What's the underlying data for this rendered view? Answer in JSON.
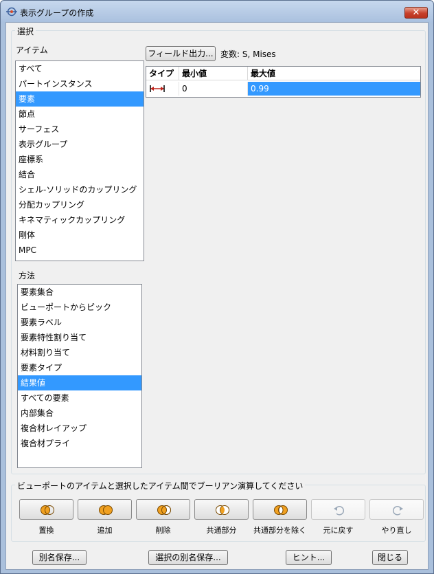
{
  "window": {
    "title": "表示グループの作成",
    "close_label": "✕"
  },
  "selection": {
    "legend": "選択",
    "items_label": "アイテム",
    "items": [
      {
        "label": "すべて",
        "selected": false
      },
      {
        "label": "パートインスタンス",
        "selected": false
      },
      {
        "label": "要素",
        "selected": true
      },
      {
        "label": "節点",
        "selected": false
      },
      {
        "label": "サーフェス",
        "selected": false
      },
      {
        "label": "表示グループ",
        "selected": false
      },
      {
        "label": "座標系",
        "selected": false
      },
      {
        "label": "結合",
        "selected": false
      },
      {
        "label": "シェル-ソリッドのカップリング",
        "selected": false
      },
      {
        "label": "分配カップリング",
        "selected": false
      },
      {
        "label": "キネマティックカップリング",
        "selected": false
      },
      {
        "label": "剛体",
        "selected": false
      },
      {
        "label": "MPC",
        "selected": false
      }
    ],
    "method_label": "方法",
    "methods": [
      {
        "label": "要素集合",
        "selected": false
      },
      {
        "label": "ビューポートからピック",
        "selected": false
      },
      {
        "label": "要素ラベル",
        "selected": false
      },
      {
        "label": "要素特性割り当て",
        "selected": false
      },
      {
        "label": "材料割り当て",
        "selected": false
      },
      {
        "label": "要素タイプ",
        "selected": false
      },
      {
        "label": "結果値",
        "selected": true
      },
      {
        "label": "すべての要素",
        "selected": false
      },
      {
        "label": "内部集合",
        "selected": false
      },
      {
        "label": "複合材レイアップ",
        "selected": false
      },
      {
        "label": "複合材プライ",
        "selected": false
      }
    ],
    "field_output_button": "フィールド出力...",
    "variable_text": "変数: S, Mises",
    "table": {
      "headers": [
        "タイプ",
        "最小値",
        "最大値"
      ],
      "row": {
        "min": "0",
        "max": "0.99"
      }
    }
  },
  "boolean": {
    "legend": "ビューポートのアイテムと選択したアイテム間でブーリアン演算してください",
    "buttons": [
      {
        "label": "置換",
        "icon": "replace-icon"
      },
      {
        "label": "追加",
        "icon": "union-icon"
      },
      {
        "label": "削除",
        "icon": "remove-icon"
      },
      {
        "label": "共通部分",
        "icon": "intersect-icon"
      },
      {
        "label": "共通部分を除く",
        "icon": "exclusive-or-icon"
      },
      {
        "label": "元に戻す",
        "icon": "undo-icon"
      },
      {
        "label": "やり直し",
        "icon": "redo-icon"
      }
    ]
  },
  "footer": {
    "save_as": "別名保存...",
    "save_selection_as": "選択の別名保存...",
    "hint": "ヒント...",
    "close": "閉じる"
  },
  "colors": {
    "selection": "#3399ff",
    "accent_orange": "#f0a020"
  }
}
